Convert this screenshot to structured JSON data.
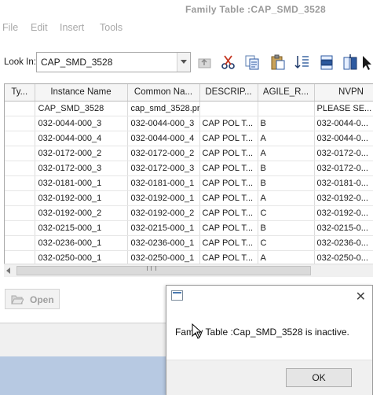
{
  "window": {
    "title": "Family Table :CAP_SMD_3528"
  },
  "menu": [
    "File",
    "Edit",
    "Insert",
    "Tools"
  ],
  "lookin": {
    "label": "Look In:",
    "value": "CAP_SMD_3528"
  },
  "toolbar": {
    "icons": [
      "up-folder-icon",
      "cut-icon",
      "copy-icon",
      "paste-icon",
      "sort-icon",
      "insert-row-icon",
      "add-column-icon",
      "cursor-icon"
    ]
  },
  "table": {
    "columns": [
      "Ty...",
      "Instance Name",
      "Common Na...",
      "DESCRIP...",
      "AGILE_R...",
      "NVPN"
    ],
    "rows": [
      [
        "",
        "CAP_SMD_3528",
        "cap_smd_3528.prt",
        "",
        "",
        "PLEASE SE..."
      ],
      [
        "",
        "032-0044-000_3",
        "032-0044-000_3",
        "CAP POL T...",
        "B",
        "032-0044-0..."
      ],
      [
        "",
        "032-0044-000_4",
        "032-0044-000_4",
        "CAP POL T...",
        "A",
        "032-0044-0..."
      ],
      [
        "",
        "032-0172-000_2",
        "032-0172-000_2",
        "CAP POL T...",
        "A",
        "032-0172-0..."
      ],
      [
        "",
        "032-0172-000_3",
        "032-0172-000_3",
        "CAP POL T...",
        "B",
        "032-0172-0..."
      ],
      [
        "",
        "032-0181-000_1",
        "032-0181-000_1",
        "CAP POL T...",
        "B",
        "032-0181-0..."
      ],
      [
        "",
        "032-0192-000_1",
        "032-0192-000_1",
        "CAP POL T...",
        "A",
        "032-0192-0..."
      ],
      [
        "",
        "032-0192-000_2",
        "032-0192-000_2",
        "CAP POL T...",
        "C",
        "032-0192-0..."
      ],
      [
        "",
        "032-0215-000_1",
        "032-0215-000_1",
        "CAP POL T...",
        "B",
        "032-0215-0..."
      ],
      [
        "",
        "032-0236-000_1",
        "032-0236-000_1",
        "CAP POL T...",
        "C",
        "032-0236-0..."
      ],
      [
        "",
        "032-0250-000_1",
        "032-0250-000_1",
        "CAP POL T...",
        "A",
        "032-0250-0..."
      ]
    ]
  },
  "open_button": {
    "label": "Open",
    "icon": "folder-open-icon"
  },
  "dialog": {
    "message": "Family Table :Cap_SMD_3528 is inactive.",
    "ok_label": "OK",
    "close_glyph": "✕"
  },
  "colors": {
    "accent_blue": "#4a7ab0",
    "bottom_bar": "#b7c9e2"
  }
}
